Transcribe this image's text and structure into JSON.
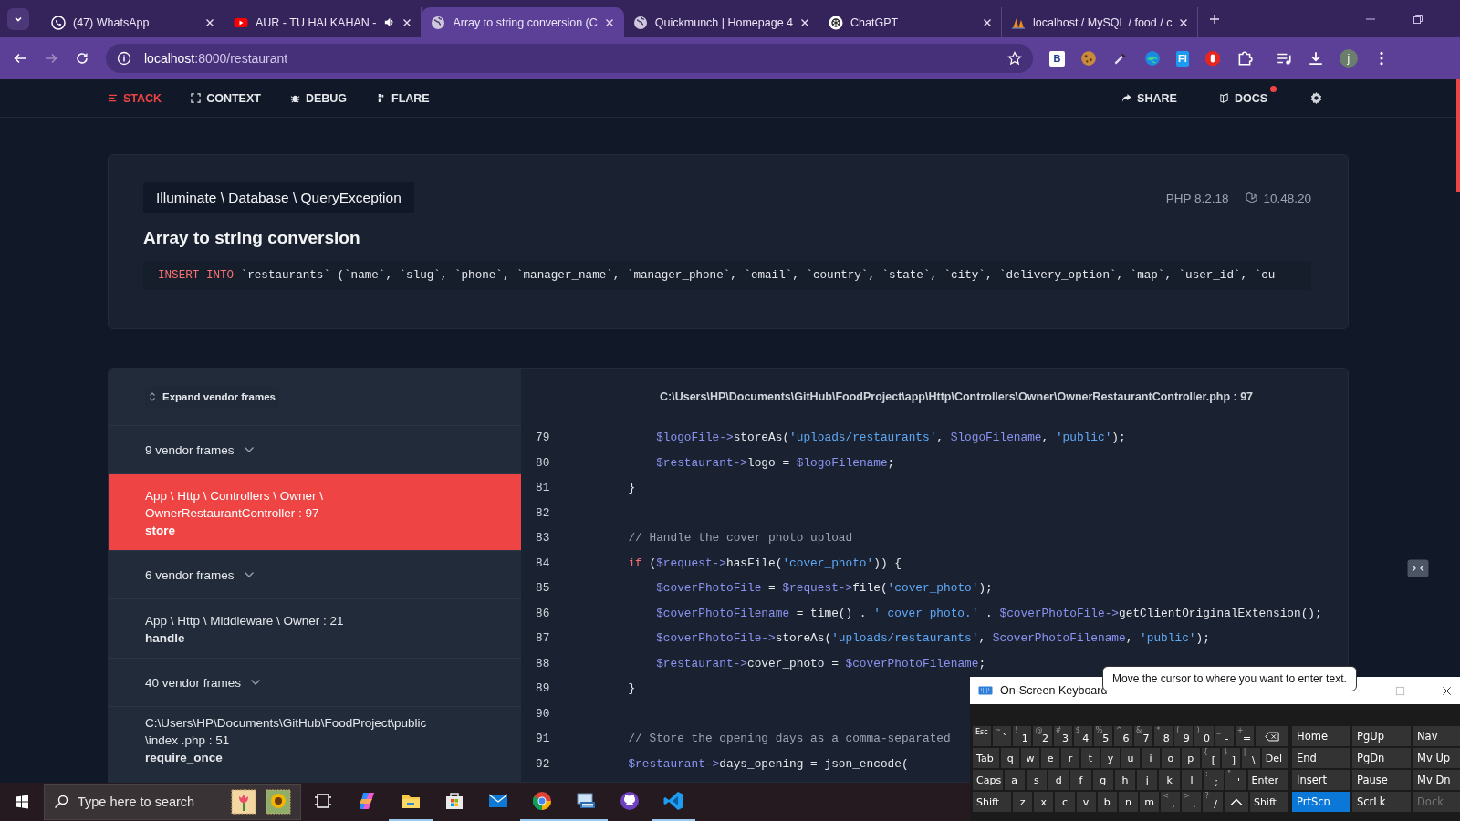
{
  "browser": {
    "tabs": [
      {
        "kind": "whatsapp",
        "title": "(47) WhatsApp",
        "selected": false,
        "audio": false
      },
      {
        "kind": "youtube",
        "title": "AUR - TU HAI KAHAN -",
        "selected": false,
        "audio": true
      },
      {
        "kind": "globe",
        "title": "Array to string conversion (C",
        "selected": true,
        "audio": false
      },
      {
        "kind": "globe",
        "title": "Quickmunch | Homepage 4",
        "selected": false,
        "audio": false
      },
      {
        "kind": "chatgpt",
        "title": "ChatGPT",
        "selected": false,
        "audio": false
      },
      {
        "kind": "sail",
        "title": "localhost / MySQL / food / c",
        "selected": false,
        "audio": false
      }
    ],
    "url": {
      "host": "localhost",
      "path": ":8000/restaurant"
    },
    "extensions": [
      {
        "kind": "letter",
        "label": "B"
      },
      {
        "kind": "cookie"
      },
      {
        "kind": "dropper"
      },
      {
        "kind": "edge"
      },
      {
        "kind": "letter-blue",
        "label": "FI"
      },
      {
        "kind": "stop"
      },
      {
        "kind": "puzzle"
      },
      {
        "kind": "media"
      },
      {
        "kind": "download"
      },
      {
        "kind": "avatar",
        "label": "j"
      }
    ]
  },
  "nav": {
    "items": [
      {
        "kind": "stack",
        "label": "STACK",
        "selected": true
      },
      {
        "kind": "context",
        "label": "CONTEXT",
        "selected": false
      },
      {
        "kind": "debug",
        "label": "DEBUG",
        "selected": false
      },
      {
        "kind": "flare",
        "label": "FLARE",
        "selected": false
      }
    ],
    "right": [
      {
        "kind": "share",
        "label": "SHARE",
        "badge": false
      },
      {
        "kind": "docs",
        "label": "DOCS",
        "badge": true
      }
    ]
  },
  "exception": {
    "class": "Illuminate \\ Database \\ QueryException",
    "php": "PHP 8.2.18",
    "laravel": "10.48.20",
    "message": "Array to string conversion",
    "sql_keyword": "INSERT INTO",
    "sql": " `restaurants` (`name`, `slug`, `phone`, `manager_name`, `manager_phone`, `email`, `country`, `state`, `city`, `delivery_option`, `map`, `user_id`, `cu"
  },
  "stack": {
    "expand": "Expand vendor frames",
    "frames": [
      {
        "kind": "vendor",
        "label": "9 vendor frames",
        "selected": false
      },
      {
        "kind": "frame",
        "location": "App \\ Http \\ Controllers \\ Owner \\ OwnerRestaurantController : 97",
        "method": "store",
        "selected": true
      },
      {
        "kind": "vendor",
        "label": "6 vendor frames",
        "selected": false
      },
      {
        "kind": "frame",
        "location": "App \\ Http \\ Middleware \\ Owner : 21",
        "method": "handle",
        "selected": false
      },
      {
        "kind": "vendor",
        "label": "40 vendor frames",
        "selected": false
      },
      {
        "kind": "frame",
        "location": "C:\\Users\\HP\\Documents\\GitHub\\FoodProject\\public\\index .php : 51",
        "method": "require_once",
        "selected": false
      }
    ],
    "file": "C:\\Users\\HP\\Documents\\GitHub\\FoodProject\\app\\Http\\Controllers\\Owner\\OwnerRestaurantController.php : 97",
    "code": [
      {
        "no": "79",
        "tokens": [
          {
            "kind": "var",
            "text": "            $logoFile->"
          },
          {
            "kind": "plain",
            "text": "storeAs("
          },
          {
            "kind": "str",
            "text": "'uploads/restaurants'"
          },
          {
            "kind": "plain",
            "text": ", "
          },
          {
            "kind": "var",
            "text": "$logoFilename"
          },
          {
            "kind": "plain",
            "text": ", "
          },
          {
            "kind": "str",
            "text": "'public'"
          },
          {
            "kind": "plain",
            "text": ");"
          }
        ]
      },
      {
        "no": "80",
        "tokens": [
          {
            "kind": "var",
            "text": "            $restaurant->"
          },
          {
            "kind": "plain",
            "text": "logo = "
          },
          {
            "kind": "var",
            "text": "$logoFilename"
          },
          {
            "kind": "plain",
            "text": ";"
          }
        ]
      },
      {
        "no": "81",
        "tokens": [
          {
            "kind": "plain",
            "text": "        }"
          }
        ]
      },
      {
        "no": "82"
      },
      {
        "no": "83",
        "tokens": [
          {
            "kind": "comment",
            "text": "        // Handle the cover photo upload"
          }
        ]
      },
      {
        "no": "84",
        "tokens": [
          {
            "kind": "keyword",
            "text": "        if"
          },
          {
            "kind": "plain",
            "text": " ("
          },
          {
            "kind": "var",
            "text": "$request->"
          },
          {
            "kind": "plain",
            "text": "hasFile("
          },
          {
            "kind": "str",
            "text": "'cover_photo'"
          },
          {
            "kind": "plain",
            "text": ")) {"
          }
        ]
      },
      {
        "no": "85",
        "tokens": [
          {
            "kind": "var",
            "text": "            $coverPhotoFile"
          },
          {
            "kind": "plain",
            "text": " = "
          },
          {
            "kind": "var",
            "text": "$request->"
          },
          {
            "kind": "plain",
            "text": "file("
          },
          {
            "kind": "str",
            "text": "'cover_photo'"
          },
          {
            "kind": "plain",
            "text": ");"
          }
        ]
      },
      {
        "no": "86",
        "tokens": [
          {
            "kind": "var",
            "text": "            $coverPhotoFilename"
          },
          {
            "kind": "plain",
            "text": " = time() . "
          },
          {
            "kind": "str",
            "text": "'_cover_photo.'"
          },
          {
            "kind": "plain",
            "text": " . "
          },
          {
            "kind": "var",
            "text": "$coverPhotoFile->"
          },
          {
            "kind": "plain",
            "text": "getClientOriginalExtension();"
          }
        ]
      },
      {
        "no": "87",
        "tokens": [
          {
            "kind": "var",
            "text": "            $coverPhotoFile->"
          },
          {
            "kind": "plain",
            "text": "storeAs("
          },
          {
            "kind": "str",
            "text": "'uploads/restaurants'"
          },
          {
            "kind": "plain",
            "text": ", "
          },
          {
            "kind": "var",
            "text": "$coverPhotoFilename"
          },
          {
            "kind": "plain",
            "text": ", "
          },
          {
            "kind": "str",
            "text": "'public'"
          },
          {
            "kind": "plain",
            "text": ");"
          }
        ]
      },
      {
        "no": "88",
        "tokens": [
          {
            "kind": "var",
            "text": "            $restaurant->"
          },
          {
            "kind": "plain",
            "text": "cover_photo = "
          },
          {
            "kind": "var",
            "text": "$coverPhotoFilename"
          },
          {
            "kind": "plain",
            "text": ";"
          }
        ]
      },
      {
        "no": "89",
        "tokens": [
          {
            "kind": "plain",
            "text": "        }"
          }
        ]
      },
      {
        "no": "90"
      },
      {
        "no": "91",
        "tokens": [
          {
            "kind": "comment",
            "text": "        // Store the opening days as a comma-separated"
          }
        ]
      },
      {
        "no": "92",
        "tokens": [
          {
            "kind": "var",
            "text": "        $restaurant->"
          },
          {
            "kind": "plain",
            "text": "days_opening = json_encode("
          }
        ]
      }
    ]
  },
  "osk": {
    "title": "On-Screen Keyboard",
    "tooltip": "Move the cursor to where you want to enter text.",
    "rows": [
      {
        "keys": [
          {
            "kind": "small",
            "label": "Esc"
          },
          {
            "kind": "char",
            "shift": "~",
            "label": "`"
          },
          {
            "kind": "char",
            "shift": "!",
            "label": "1"
          },
          {
            "kind": "char",
            "shift": "@",
            "label": "2"
          },
          {
            "kind": "char",
            "shift": "#",
            "label": "3"
          },
          {
            "kind": "char",
            "shift": "$",
            "label": "4"
          },
          {
            "kind": "char",
            "shift": "%",
            "label": "5"
          },
          {
            "kind": "char",
            "shift": "^",
            "label": "6"
          },
          {
            "kind": "char",
            "shift": "&",
            "label": "7"
          },
          {
            "kind": "char",
            "shift": "*",
            "label": "8"
          },
          {
            "kind": "char",
            "shift": "(",
            "label": "9"
          },
          {
            "kind": "char",
            "shift": ")",
            "label": "0"
          },
          {
            "kind": "char",
            "shift": "_",
            "label": "-"
          },
          {
            "kind": "char",
            "shift": "+",
            "label": "="
          },
          {
            "kind": "backspace"
          }
        ]
      },
      {
        "keys": [
          {
            "kind": "wide",
            "label": "Tab"
          },
          {
            "kind": "char",
            "label": "q"
          },
          {
            "kind": "char",
            "label": "w"
          },
          {
            "kind": "char",
            "label": "e"
          },
          {
            "kind": "char",
            "label": "r"
          },
          {
            "kind": "char",
            "label": "t"
          },
          {
            "kind": "char",
            "label": "y"
          },
          {
            "kind": "char",
            "label": "u"
          },
          {
            "kind": "char",
            "label": "i"
          },
          {
            "kind": "char",
            "label": "o"
          },
          {
            "kind": "char",
            "label": "p"
          },
          {
            "kind": "char",
            "shift": "{",
            "label": "["
          },
          {
            "kind": "char",
            "shift": "}",
            "label": "]"
          },
          {
            "kind": "char",
            "shift": "|",
            "label": "\\"
          },
          {
            "kind": "wide",
            "label": "Del"
          }
        ]
      },
      {
        "keys": [
          {
            "kind": "wide",
            "label": "Caps"
          },
          {
            "kind": "char",
            "label": "a"
          },
          {
            "kind": "char",
            "label": "s"
          },
          {
            "kind": "char",
            "label": "d"
          },
          {
            "kind": "char",
            "label": "f"
          },
          {
            "kind": "char",
            "label": "g"
          },
          {
            "kind": "char",
            "label": "h"
          },
          {
            "kind": "char",
            "label": "j"
          },
          {
            "kind": "char",
            "label": "k"
          },
          {
            "kind": "char",
            "label": "l"
          },
          {
            "kind": "char",
            "shift": ":",
            "label": ";"
          },
          {
            "kind": "char",
            "shift": "\"",
            "label": "'"
          },
          {
            "kind": "wider",
            "label": "Enter"
          }
        ]
      },
      {
        "keys": [
          {
            "kind": "wider",
            "label": "Shift"
          },
          {
            "kind": "char",
            "label": "z"
          },
          {
            "kind": "char",
            "label": "x"
          },
          {
            "kind": "char",
            "label": "c"
          },
          {
            "kind": "char",
            "label": "v"
          },
          {
            "kind": "char",
            "label": "b"
          },
          {
            "kind": "char",
            "label": "n"
          },
          {
            "kind": "char",
            "label": "m"
          },
          {
            "kind": "char",
            "shift": "<",
            "label": ","
          },
          {
            "kind": "char",
            "shift": ">",
            "label": "."
          },
          {
            "kind": "char",
            "shift": "?",
            "label": "/"
          },
          {
            "kind": "up"
          },
          {
            "kind": "wider",
            "label": "Shift"
          }
        ]
      }
    ],
    "nav_keys": [
      [
        {
          "label": "Home",
          "selected": false,
          "disabled": false
        },
        {
          "label": "PgUp",
          "selected": false,
          "disabled": false
        },
        {
          "label": "Nav",
          "selected": false,
          "disabled": false
        }
      ],
      [
        {
          "label": "End",
          "selected": false,
          "disabled": false
        },
        {
          "label": "PgDn",
          "selected": false,
          "disabled": false
        },
        {
          "label": "Mv Up",
          "selected": false,
          "disabled": false
        }
      ],
      [
        {
          "label": "Insert",
          "selected": false,
          "disabled": false
        },
        {
          "label": "Pause",
          "selected": false,
          "disabled": false
        },
        {
          "label": "Mv Dn",
          "selected": false,
          "disabled": false
        }
      ],
      [
        {
          "label": "PrtScn",
          "selected": true,
          "disabled": false
        },
        {
          "label": "ScrLk",
          "selected": false,
          "disabled": false
        },
        {
          "label": "Dock",
          "selected": false,
          "disabled": true
        }
      ]
    ]
  },
  "taskbar": {
    "search": "Type here to search",
    "apps": [
      {
        "kind": "taskview",
        "active": false
      },
      {
        "kind": "copilot",
        "active": false
      },
      {
        "kind": "explorer",
        "active": true
      },
      {
        "kind": "store",
        "active": false
      },
      {
        "kind": "mail",
        "active": false
      },
      {
        "kind": "chrome",
        "active": true
      },
      {
        "kind": "osk",
        "active": true
      },
      {
        "kind": "github",
        "active": false
      },
      {
        "kind": "vscode",
        "active": true
      }
    ]
  }
}
